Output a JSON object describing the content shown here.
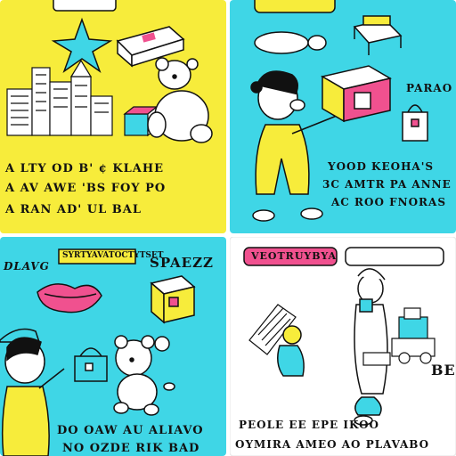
{
  "colors": {
    "yellow": "#f7ec3b",
    "cyan": "#3fd6e6",
    "pink": "#f0518f",
    "white": "#ffffff",
    "ink": "#111111"
  },
  "panels": [
    {
      "position": "top-left",
      "background": "#f7ec3b",
      "caption_lines": [
        "A LTY OD B' ¢ KLAHE",
        "A AV AWE 'BS FOY PO",
        "A RAN AD' UL BAL"
      ]
    },
    {
      "position": "top-right",
      "background": "#3fd6e6",
      "sign_text": "PARAO",
      "caption_lines": [
        "YOOD KEOHA'S",
        "3C AMTR PA ANNE",
        "AC ROO FNORAS"
      ]
    },
    {
      "position": "bottom-left",
      "background": "#3fd6e6",
      "banner_text": "SYRTYAVATOCTYTSET",
      "caption_top_left": "DLAVG",
      "caption_top_right": "SPAEZZ",
      "caption_lines": [
        "DO OAW AU ALIAVO",
        "NO OZDE RIK BAD"
      ]
    },
    {
      "position": "bottom-right",
      "background": "#ffffff",
      "banner_text": "VEOTRUYBYA",
      "side_text": "BE",
      "caption_lines": [
        "PEOLE EE EPE IKOO",
        "OYMIRA AMEO AO PLAVABO"
      ]
    }
  ]
}
